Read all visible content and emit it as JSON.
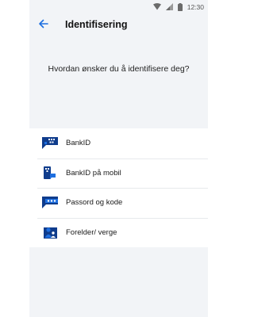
{
  "status_bar": {
    "time": "12:30",
    "icons": [
      "wifi-icon",
      "signal-icon",
      "battery-icon"
    ]
  },
  "header": {
    "back_icon": "arrow-left-icon",
    "title": "Identifisering"
  },
  "question": "Hvordan ønsker du å identifisere deg?",
  "options": [
    {
      "label": "BankID",
      "icon": "bankid-icon"
    },
    {
      "label": "BankID på mobil",
      "icon": "bankid-mobile-icon"
    },
    {
      "label": "Passord og kode",
      "icon": "password-icon"
    },
    {
      "label": "Forelder/ verge",
      "icon": "guardian-icon"
    }
  ],
  "colors": {
    "accent": "#1e6fe0",
    "icon_dark": "#0f3c8c",
    "background": "#f2f4f7",
    "list_background": "#ffffff"
  }
}
